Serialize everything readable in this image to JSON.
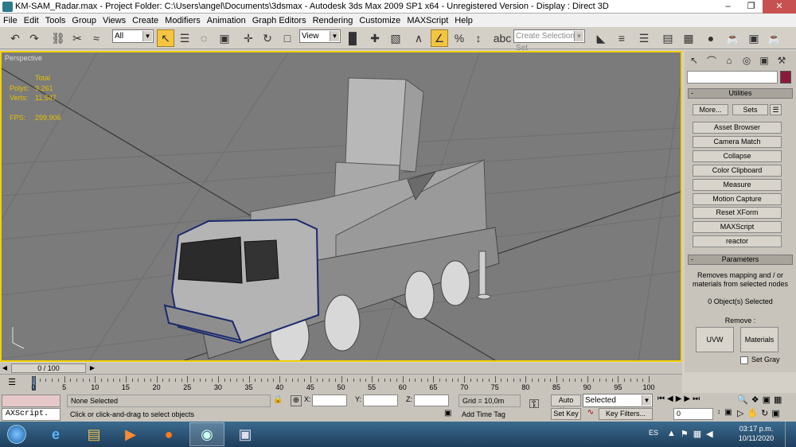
{
  "window": {
    "title": "KM-SAM_Radar.max    - Project Folder: C:\\Users\\angel\\Documents\\3dsmax    - Autodesk 3ds Max  2009 SP1  x64   - Unregistered Version    - Display : Direct 3D"
  },
  "menu": [
    "File",
    "Edit",
    "Tools",
    "Group",
    "Views",
    "Create",
    "Modifiers",
    "Animation",
    "Graph Editors",
    "Rendering",
    "Customize",
    "MAXScript",
    "Help"
  ],
  "toolbar": {
    "selection_filter": "All",
    "reference_coord": "View",
    "named_selection_placeholder": "Create Selection Set"
  },
  "viewport": {
    "label": "Perspective",
    "stats": {
      "header": "Total",
      "polys_label": "Polys:",
      "polys_value": "9.261",
      "verts_label": "Verts:",
      "verts_value": "11.547",
      "fps_label": "FPS:",
      "fps_value": "299.906"
    }
  },
  "command_panel": {
    "utilities_title": "Utilities",
    "more_label": "More...",
    "sets_label": "Sets",
    "utility_buttons": [
      "Asset Browser",
      "Camera Match",
      "Collapse",
      "Color Clipboard",
      "Measure",
      "Motion Capture",
      "Reset XForm",
      "MAXScript",
      "reactor"
    ],
    "parameters_title": "Parameters",
    "description": "Removes mapping and / or materials from selected nodes",
    "selected_text": "0 Object(s) Selected",
    "remove_label": "Remove :",
    "uvw_label": "UVW",
    "materials_label": "Materials",
    "set_gray_label": "Set Gray"
  },
  "timeline": {
    "frame_display": "0 / 100",
    "ticks": [
      "0",
      "5",
      "10",
      "15",
      "20",
      "25",
      "30",
      "35",
      "40",
      "45",
      "50",
      "55",
      "60",
      "65",
      "70",
      "75",
      "80",
      "85",
      "90",
      "95",
      "100"
    ]
  },
  "status": {
    "maxscript_label": "AXScript.",
    "selection_status": "None Selected",
    "prompt": "Click or click-and-drag to select objects",
    "x_label": "X:",
    "y_label": "Y:",
    "z_label": "Z:",
    "grid": "Grid = 10,0m",
    "add_time_tag": "Add Time Tag",
    "auto_key": "Auto Key",
    "set_key": "Set Key",
    "key_mode": "Selected",
    "key_filters": "Key Filters...",
    "current_frame": "0"
  },
  "taskbar": {
    "lang": "ES",
    "time": "03:17 p.m.",
    "date": "10/11/2020"
  }
}
